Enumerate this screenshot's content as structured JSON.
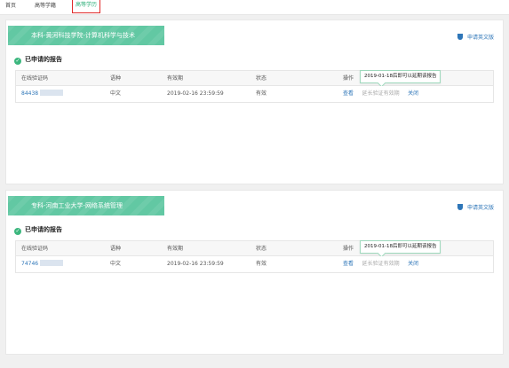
{
  "nav": {
    "tabs": [
      "首页",
      "高等学籍",
      "高等学历"
    ],
    "active_index": 2
  },
  "colors": {
    "accent": "#2cae78",
    "banner": "#62c8a3",
    "link": "#2e76b8",
    "active_border": "#e02a2a"
  },
  "table_headers": [
    "在线验证码",
    "语种",
    "有效期",
    "状态",
    "操作"
  ],
  "tooltip": "2019-01-18后即可以延期该报告",
  "apply_english": "申请英文版",
  "section_title": "已申请的报告",
  "cards": [
    {
      "banner": "本科-黄河科技学院-计算机科学与技术",
      "row": {
        "code": "84438",
        "language": "中文",
        "expiry": "2019-02-16 23:59:59",
        "status": "有效",
        "view": "查看",
        "extend": "延长验证有效期",
        "close": "关闭"
      }
    },
    {
      "banner": "专科-河南工业大学-网络系统管理",
      "row": {
        "code": "74746",
        "language": "中文",
        "expiry": "2019-02-16 23:59:59",
        "status": "有效",
        "view": "查看",
        "extend": "延长验证有效期",
        "close": "关闭"
      }
    }
  ]
}
